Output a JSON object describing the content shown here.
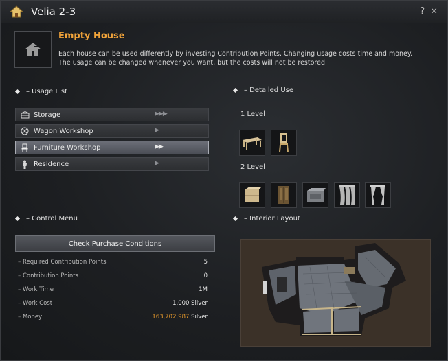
{
  "window": {
    "title": "Velia 2-3",
    "help": "?",
    "close": "×"
  },
  "header": {
    "title": "Empty House",
    "desc1": "Each house can be used differently by investing Contribution Points. Changing usage costs time and money.",
    "desc2": "The usage can be changed whenever you want, but the costs will not be restored."
  },
  "sections": {
    "usage": "– Usage List",
    "detailed": "– Detailed Use",
    "control": "– Control Menu",
    "interior": "– Interior Layout"
  },
  "usage_list": [
    {
      "label": "Storage",
      "icon": "storage-icon",
      "arrows": "▶▶▶"
    },
    {
      "label": "Wagon Workshop",
      "icon": "wagon-wheel-icon",
      "arrows": "▶"
    },
    {
      "label": "Furniture Workshop",
      "icon": "chair-icon",
      "arrows": "▶▶"
    },
    {
      "label": "Residence",
      "icon": "person-icon",
      "arrows": "▶"
    }
  ],
  "levels": [
    {
      "label": "1 Level",
      "items": [
        "table-icon",
        "chair-icon"
      ]
    },
    {
      "label": "2 Level",
      "items": [
        "cabinet-icon",
        "wardrobe-icon",
        "chest-icon",
        "curtain-icon",
        "curtain-tied-icon"
      ]
    }
  ],
  "control": {
    "button": "Check Purchase Conditions",
    "stats": [
      {
        "label": "Required Contribution Points",
        "value": "5"
      },
      {
        "label": "Contribution Points",
        "value": "0"
      },
      {
        "label": "Work Time",
        "value": "1M"
      },
      {
        "label": "Work Cost",
        "value": "1,000 Silver"
      },
      {
        "label": "Money",
        "value_gold": "163,702,987",
        "value": " Silver"
      }
    ]
  },
  "colors": {
    "accent": "#f0a33a",
    "gold": "#e89a2b"
  }
}
